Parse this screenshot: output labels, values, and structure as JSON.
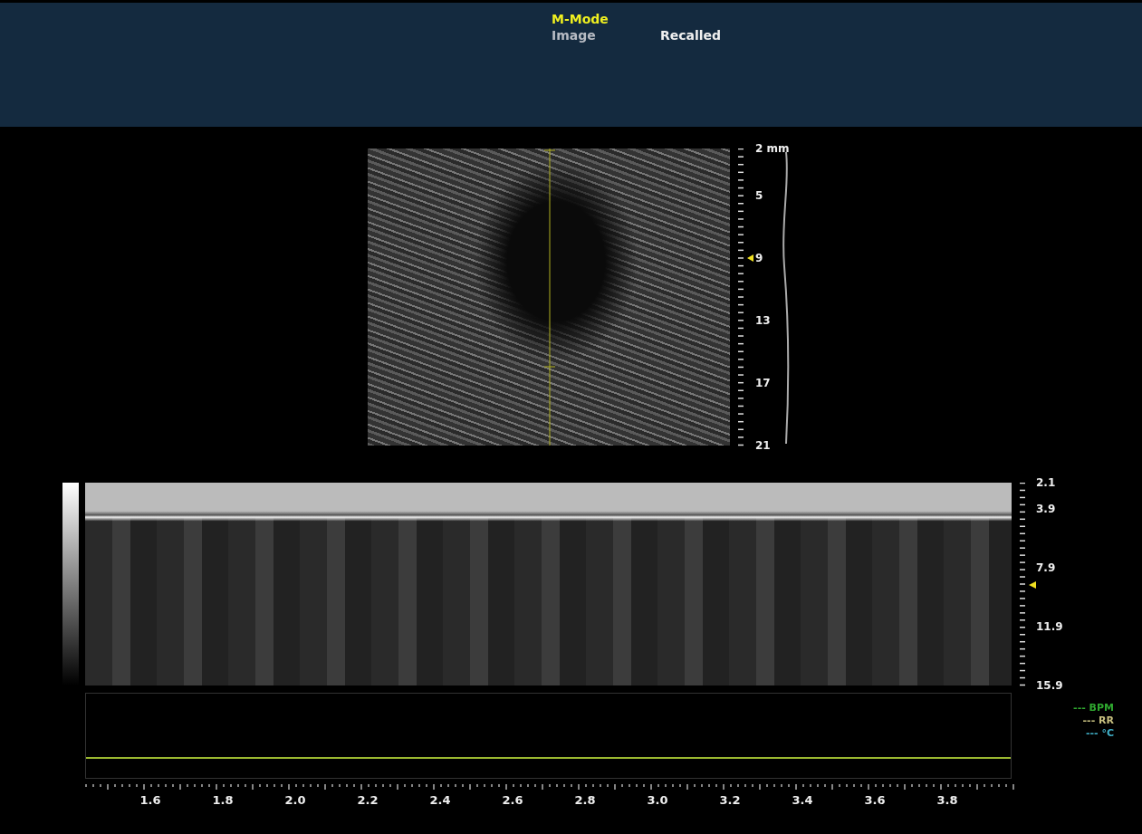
{
  "header": {
    "mode": "M-Mode",
    "view": "Image",
    "status": "Recalled"
  },
  "b_mode": {
    "depth_labels": [
      "2 mm",
      "5",
      "9",
      "13",
      "17",
      "21"
    ]
  },
  "m_mode": {
    "depth_labels": [
      "2.1",
      "3.9",
      "7.9",
      "11.9",
      "15.9"
    ]
  },
  "physio_legend": [
    {
      "label": "--- BPM",
      "color": "#2fa82f"
    },
    {
      "label": "--- RR",
      "color": "#c8c080"
    },
    {
      "label": "--- °C",
      "color": "#40b0c8"
    }
  ],
  "time_axis": {
    "labels": [
      "1.6",
      "1.8",
      "2.0",
      "2.2",
      "2.4",
      "2.6",
      "2.8",
      "3.0",
      "3.2",
      "3.4",
      "3.6",
      "3.8"
    ]
  }
}
